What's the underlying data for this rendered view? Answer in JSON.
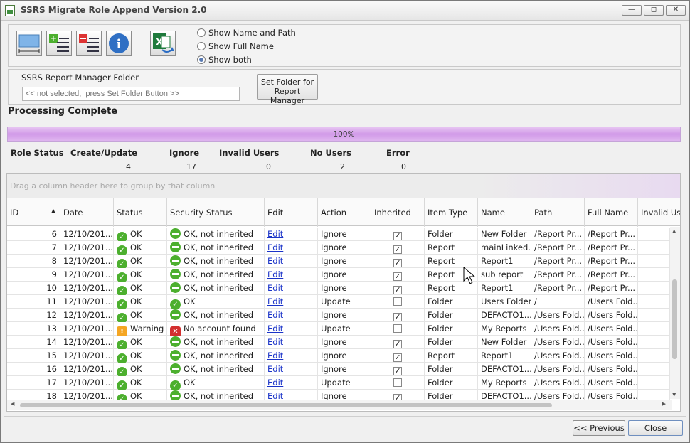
{
  "window": {
    "title": "SSRS Migrate Role Append Version 2.0"
  },
  "display_options": [
    {
      "label": "Show Name and Path",
      "selected": false
    },
    {
      "label": "Show Full Name",
      "selected": false
    },
    {
      "label": "Show both",
      "selected": true
    }
  ],
  "folder": {
    "label": "SSRS Report Manager Folder",
    "placeholder": "<< not selected,  press Set Folder Button >>",
    "button_line1": "Set Folder for",
    "button_line2": "Report Manager"
  },
  "status": {
    "text": "Processing Complete",
    "progress_label": "100%",
    "progress_value": 1.0
  },
  "stats": {
    "row_label": "Role Status",
    "headers": [
      "Create/Update",
      "Ignore",
      "Invalid Users",
      "No Users",
      "Error"
    ],
    "values": [
      "4",
      "17",
      "0",
      "2",
      "0"
    ]
  },
  "grid": {
    "group_hint": "Drag a column header here to group by that column",
    "columns": [
      "ID",
      "Date",
      "Status",
      "Security Status",
      "Edit",
      "Action",
      "Inherited",
      "Item Type",
      "Name",
      "Path",
      "Full Name",
      "Invalid User"
    ],
    "rows": [
      {
        "id": "6",
        "date": "12/10/201...",
        "status": "OK",
        "security": "OK, not inherited",
        "sec_kind": "min",
        "edit": "Edit",
        "action": "Ignore",
        "inherited": true,
        "type": "Folder",
        "name": "New Folder",
        "path": "/Report Pr...",
        "full": "/Report Pr..."
      },
      {
        "id": "7",
        "date": "12/10/201...",
        "status": "OK",
        "security": "OK, not inherited",
        "sec_kind": "min",
        "edit": "Edit",
        "action": "Ignore",
        "inherited": true,
        "type": "Report",
        "name": "mainLinked...",
        "path": "/Report Pr...",
        "full": "/Report Pr..."
      },
      {
        "id": "8",
        "date": "12/10/201...",
        "status": "OK",
        "security": "OK, not inherited",
        "sec_kind": "min",
        "edit": "Edit",
        "action": "Ignore",
        "inherited": true,
        "type": "Report",
        "name": "Report1",
        "path": "/Report Pr...",
        "full": "/Report Pr..."
      },
      {
        "id": "9",
        "date": "12/10/201...",
        "status": "OK",
        "security": "OK, not inherited",
        "sec_kind": "min",
        "edit": "Edit",
        "action": "Ignore",
        "inherited": true,
        "type": "Report",
        "name": "sub report",
        "path": "/Report Pr...",
        "full": "/Report Pr..."
      },
      {
        "id": "10",
        "date": "12/10/201...",
        "status": "OK",
        "security": "OK, not inherited",
        "sec_kind": "min",
        "edit": "Edit",
        "action": "Ignore",
        "inherited": true,
        "type": "Report",
        "name": "Report1",
        "path": "/Report Pr...",
        "full": "/Report Pr..."
      },
      {
        "id": "11",
        "date": "12/10/201...",
        "status": "OK",
        "security": "OK",
        "sec_kind": "ok",
        "edit": "Edit",
        "action": "Update",
        "inherited": false,
        "type": "Folder",
        "name": "Users Folders",
        "path": "/",
        "full": "/Users Fold..."
      },
      {
        "id": "12",
        "date": "12/10/201...",
        "status": "OK",
        "security": "OK, not inherited",
        "sec_kind": "min",
        "edit": "Edit",
        "action": "Ignore",
        "inherited": true,
        "type": "Folder",
        "name": "DEFACTO1...",
        "path": "/Users Fold...",
        "full": "/Users Fold..."
      },
      {
        "id": "13",
        "date": "12/10/201...",
        "status": "Warning",
        "security": "No account found",
        "sec_kind": "err",
        "edit": "Edit",
        "action": "Update",
        "inherited": false,
        "type": "Folder",
        "name": "My Reports",
        "path": "/Users Fold...",
        "full": "/Users Fold..."
      },
      {
        "id": "14",
        "date": "12/10/201...",
        "status": "OK",
        "security": "OK, not inherited",
        "sec_kind": "min",
        "edit": "Edit",
        "action": "Ignore",
        "inherited": true,
        "type": "Folder",
        "name": "New Folder",
        "path": "/Users Fold...",
        "full": "/Users Fold..."
      },
      {
        "id": "15",
        "date": "12/10/201...",
        "status": "OK",
        "security": "OK, not inherited",
        "sec_kind": "min",
        "edit": "Edit",
        "action": "Ignore",
        "inherited": true,
        "type": "Report",
        "name": "Report1",
        "path": "/Users Fold...",
        "full": "/Users Fold..."
      },
      {
        "id": "16",
        "date": "12/10/201...",
        "status": "OK",
        "security": "OK, not inherited",
        "sec_kind": "min",
        "edit": "Edit",
        "action": "Ignore",
        "inherited": true,
        "type": "Folder",
        "name": "DEFACTO1...",
        "path": "/Users Fold...",
        "full": "/Users Fold..."
      },
      {
        "id": "17",
        "date": "12/10/201...",
        "status": "OK",
        "security": "OK",
        "sec_kind": "ok",
        "edit": "Edit",
        "action": "Update",
        "inherited": false,
        "type": "Folder",
        "name": "My Reports",
        "path": "/Users Fold...",
        "full": "/Users Fold..."
      },
      {
        "id": "18",
        "date": "12/10/201...",
        "status": "OK",
        "security": "OK, not inherited",
        "sec_kind": "min",
        "edit": "Edit",
        "action": "Ignore",
        "inherited": true,
        "type": "Folder",
        "name": "DEFACTO1...",
        "path": "/Users Fold...",
        "full": "/Users Fold..."
      }
    ]
  },
  "footer": {
    "previous": "<< Previous",
    "close": "Close"
  },
  "icons": [
    "column-width-icon",
    "add-rows-icon",
    "remove-rows-icon",
    "info-icon",
    "excel-export-icon",
    "sort-asc-icon",
    "cursor-icon"
  ]
}
